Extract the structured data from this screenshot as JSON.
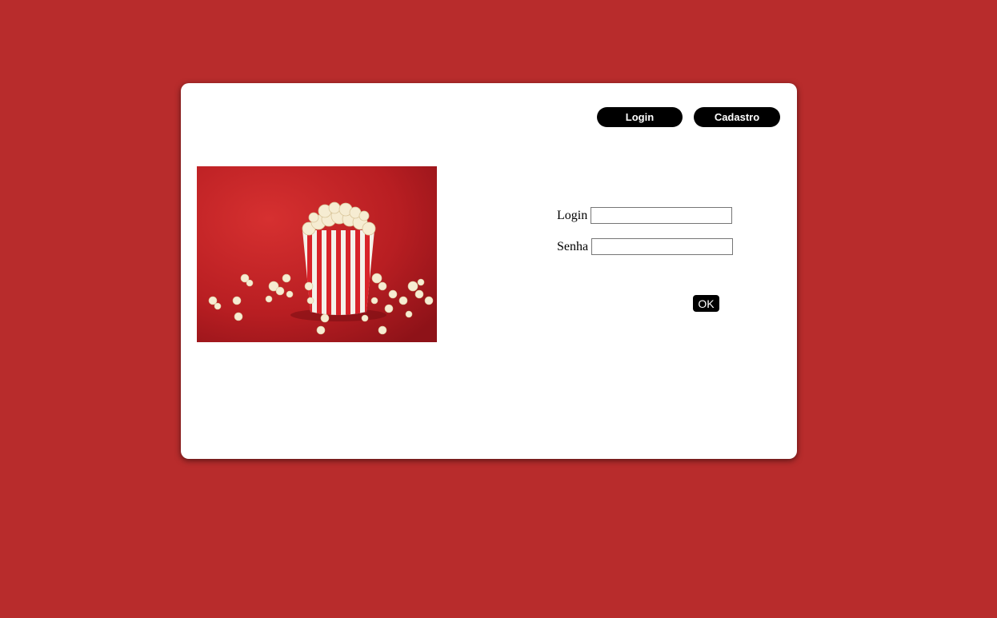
{
  "nav": {
    "login_label": "Login",
    "cadastro_label": "Cadastro"
  },
  "form": {
    "login_label": "Login",
    "login_value": "",
    "senha_label": "Senha",
    "senha_value": "",
    "submit_label": "OK"
  },
  "colors": {
    "background": "#b82c2c",
    "card": "#ffffff",
    "button": "#000000",
    "button_text": "#ffffff"
  },
  "image": {
    "subject": "popcorn-box-image"
  }
}
